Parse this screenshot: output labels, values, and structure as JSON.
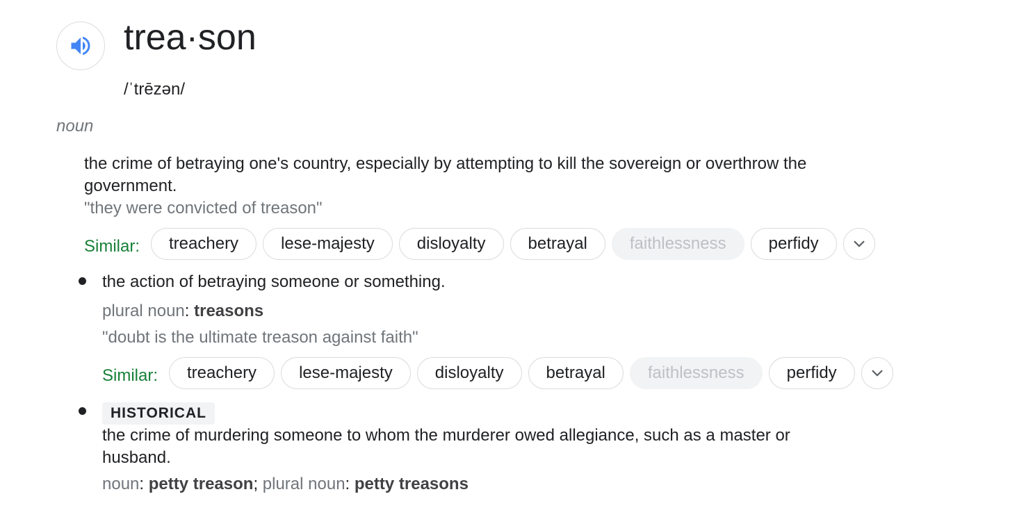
{
  "entry": {
    "headword": "trea·son",
    "phonetic": "/ˈtrēzən/",
    "part_of_speech": "noun"
  },
  "senses": [
    {
      "definition": "the crime of betraying one's country, especially by attempting to kill the sovereign or overthrow the government.",
      "definition_line1": "the crime of betraying one's country, especially by attempting to kill the sovereign or overthrow the",
      "definition_line2": "government.",
      "example": "\"they were convicted of treason\"",
      "similar_label": "Similar:",
      "similar": [
        {
          "label": "treachery",
          "enabled": true
        },
        {
          "label": "lese-majesty",
          "enabled": true
        },
        {
          "label": "disloyalty",
          "enabled": true
        },
        {
          "label": "betrayal",
          "enabled": true
        },
        {
          "label": "faithlessness",
          "enabled": false
        },
        {
          "label": "perfidy",
          "enabled": true
        }
      ]
    },
    {
      "definition": "the action of betraying someone or something.",
      "grammar_label": "plural noun",
      "grammar_sep": ":",
      "grammar_value": "treasons",
      "example": "\"doubt is the ultimate treason against faith\"",
      "similar_label": "Similar:",
      "similar": [
        {
          "label": "treachery",
          "enabled": true
        },
        {
          "label": "lese-majesty",
          "enabled": true
        },
        {
          "label": "disloyalty",
          "enabled": true
        },
        {
          "label": "betrayal",
          "enabled": true
        },
        {
          "label": "faithlessness",
          "enabled": false
        },
        {
          "label": "perfidy",
          "enabled": true
        }
      ]
    },
    {
      "tag": "HISTORICAL",
      "definition_line1": "the crime of murdering someone to whom the murderer owed allegiance, such as a master or",
      "definition_line2": "husband.",
      "grammar_label1": "noun",
      "grammar_value1": "petty treason",
      "grammar_label2": "plural noun",
      "grammar_value2": "petty treasons"
    }
  ],
  "icons": {
    "speaker": "speaker-icon",
    "expand": "chevron-down-icon"
  },
  "colors": {
    "speaker": "#4285f4",
    "similar_label": "#188038",
    "muted": "#70757a",
    "chip_border": "#dadce0",
    "disabled_chip_bg": "#f1f3f4"
  }
}
